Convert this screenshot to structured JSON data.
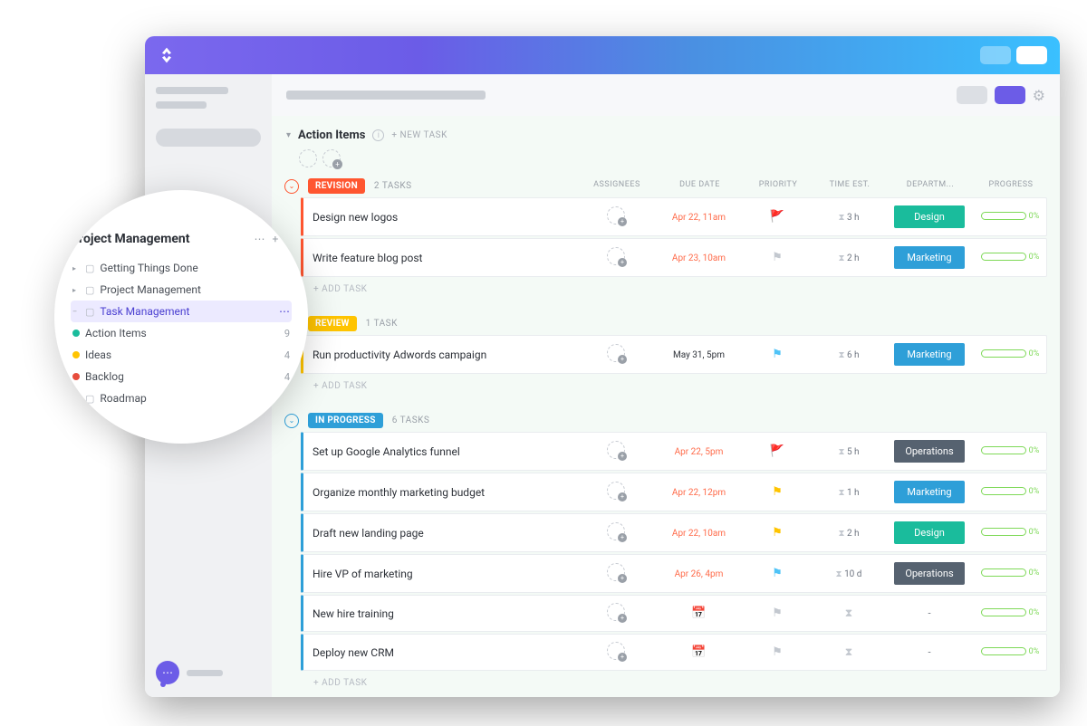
{
  "list": {
    "title": "Action Items",
    "newTask": "+ NEW TASK",
    "addTask": "+ ADD TASK"
  },
  "columns": {
    "assignees": "ASSIGNEES",
    "dueDate": "DUE DATE",
    "priority": "PRIORITY",
    "timeEst": "TIME EST.",
    "department": "DEPARTM...",
    "progress": "PROGRESS"
  },
  "groups": [
    {
      "status": "REVISION",
      "color": "#ff5630",
      "count": "2 TASKS",
      "tasks": [
        {
          "name": "Design new logos",
          "due": "Apr 22, 11am",
          "dueColor": "#ff6b4a",
          "flag": "🚩",
          "flagColor": "#ff5630",
          "time": "3 h",
          "dept": "Design",
          "deptColor": "#1abc9c",
          "pct": "0%"
        },
        {
          "name": "Write feature blog post",
          "due": "Apr 23, 10am",
          "dueColor": "#ff6b4a",
          "flag": "⚑",
          "flagColor": "#c3c8cf",
          "time": "2 h",
          "dept": "Marketing",
          "deptColor": "#2e9fd8",
          "pct": "0%"
        }
      ]
    },
    {
      "status": "REVIEW",
      "color": "#ffc400",
      "count": "1 TASK",
      "tasks": [
        {
          "name": "Run productivity Adwords campaign",
          "due": "May 31, 5pm",
          "dueColor": "#2d3138",
          "flag": "⚑",
          "flagColor": "#4fc3f7",
          "time": "6 h",
          "dept": "Marketing",
          "deptColor": "#2e9fd8",
          "pct": "0%"
        }
      ]
    },
    {
      "status": "IN PROGRESS",
      "color": "#2e9fd8",
      "count": "6 TASKS",
      "tasks": [
        {
          "name": "Set up Google Analytics funnel",
          "due": "Apr 22, 5pm",
          "dueColor": "#ff6b4a",
          "flag": "🚩",
          "flagColor": "#ff5630",
          "time": "5 h",
          "dept": "Operations",
          "deptColor": "#566270",
          "pct": "0%"
        },
        {
          "name": "Organize monthly marketing budget",
          "due": "Apr 22, 12pm",
          "dueColor": "#ff6b4a",
          "flag": "⚑",
          "flagColor": "#ffc400",
          "time": "1 h",
          "dept": "Marketing",
          "deptColor": "#2e9fd8",
          "pct": "0%"
        },
        {
          "name": "Draft new landing page",
          "due": "Apr 22, 10am",
          "dueColor": "#ff6b4a",
          "flag": "⚑",
          "flagColor": "#ffc400",
          "time": "2 h",
          "dept": "Design",
          "deptColor": "#1abc9c",
          "pct": "0%"
        },
        {
          "name": "Hire VP of marketing",
          "due": "Apr 26, 4pm",
          "dueColor": "#ff6b4a",
          "flag": "⚑",
          "flagColor": "#4fc3f7",
          "time": "10 d",
          "dept": "Operations",
          "deptColor": "#566270",
          "pct": "0%"
        },
        {
          "name": "New hire training",
          "due": "",
          "dueColor": "",
          "flag": "",
          "flagColor": "",
          "time": "",
          "dept": "-",
          "deptColor": "",
          "pct": "0%"
        },
        {
          "name": "Deploy new CRM",
          "due": "",
          "dueColor": "",
          "flag": "",
          "flagColor": "",
          "time": "",
          "dept": "-",
          "deptColor": "",
          "pct": "0%"
        }
      ]
    }
  ],
  "popup": {
    "title": "Project Management",
    "items": [
      {
        "type": "folder",
        "label": "Getting Things Done",
        "indent": 0,
        "tri": "▸"
      },
      {
        "type": "folder",
        "label": "Project Management",
        "indent": 0,
        "tri": "▸"
      },
      {
        "type": "folder-sel",
        "label": "Task Management",
        "indent": 1,
        "tri": "–"
      },
      {
        "type": "list",
        "label": "Action Items",
        "dot": "#1abc9c",
        "count": "9",
        "indent": 2
      },
      {
        "type": "list",
        "label": "Ideas",
        "dot": "#ffc400",
        "count": "4",
        "indent": 2
      },
      {
        "type": "list",
        "label": "Backlog",
        "dot": "#e74c3c",
        "count": "4",
        "indent": 2
      },
      {
        "type": "folder",
        "label": "Roadmap",
        "indent": 0,
        "tri": "▸"
      }
    ]
  }
}
